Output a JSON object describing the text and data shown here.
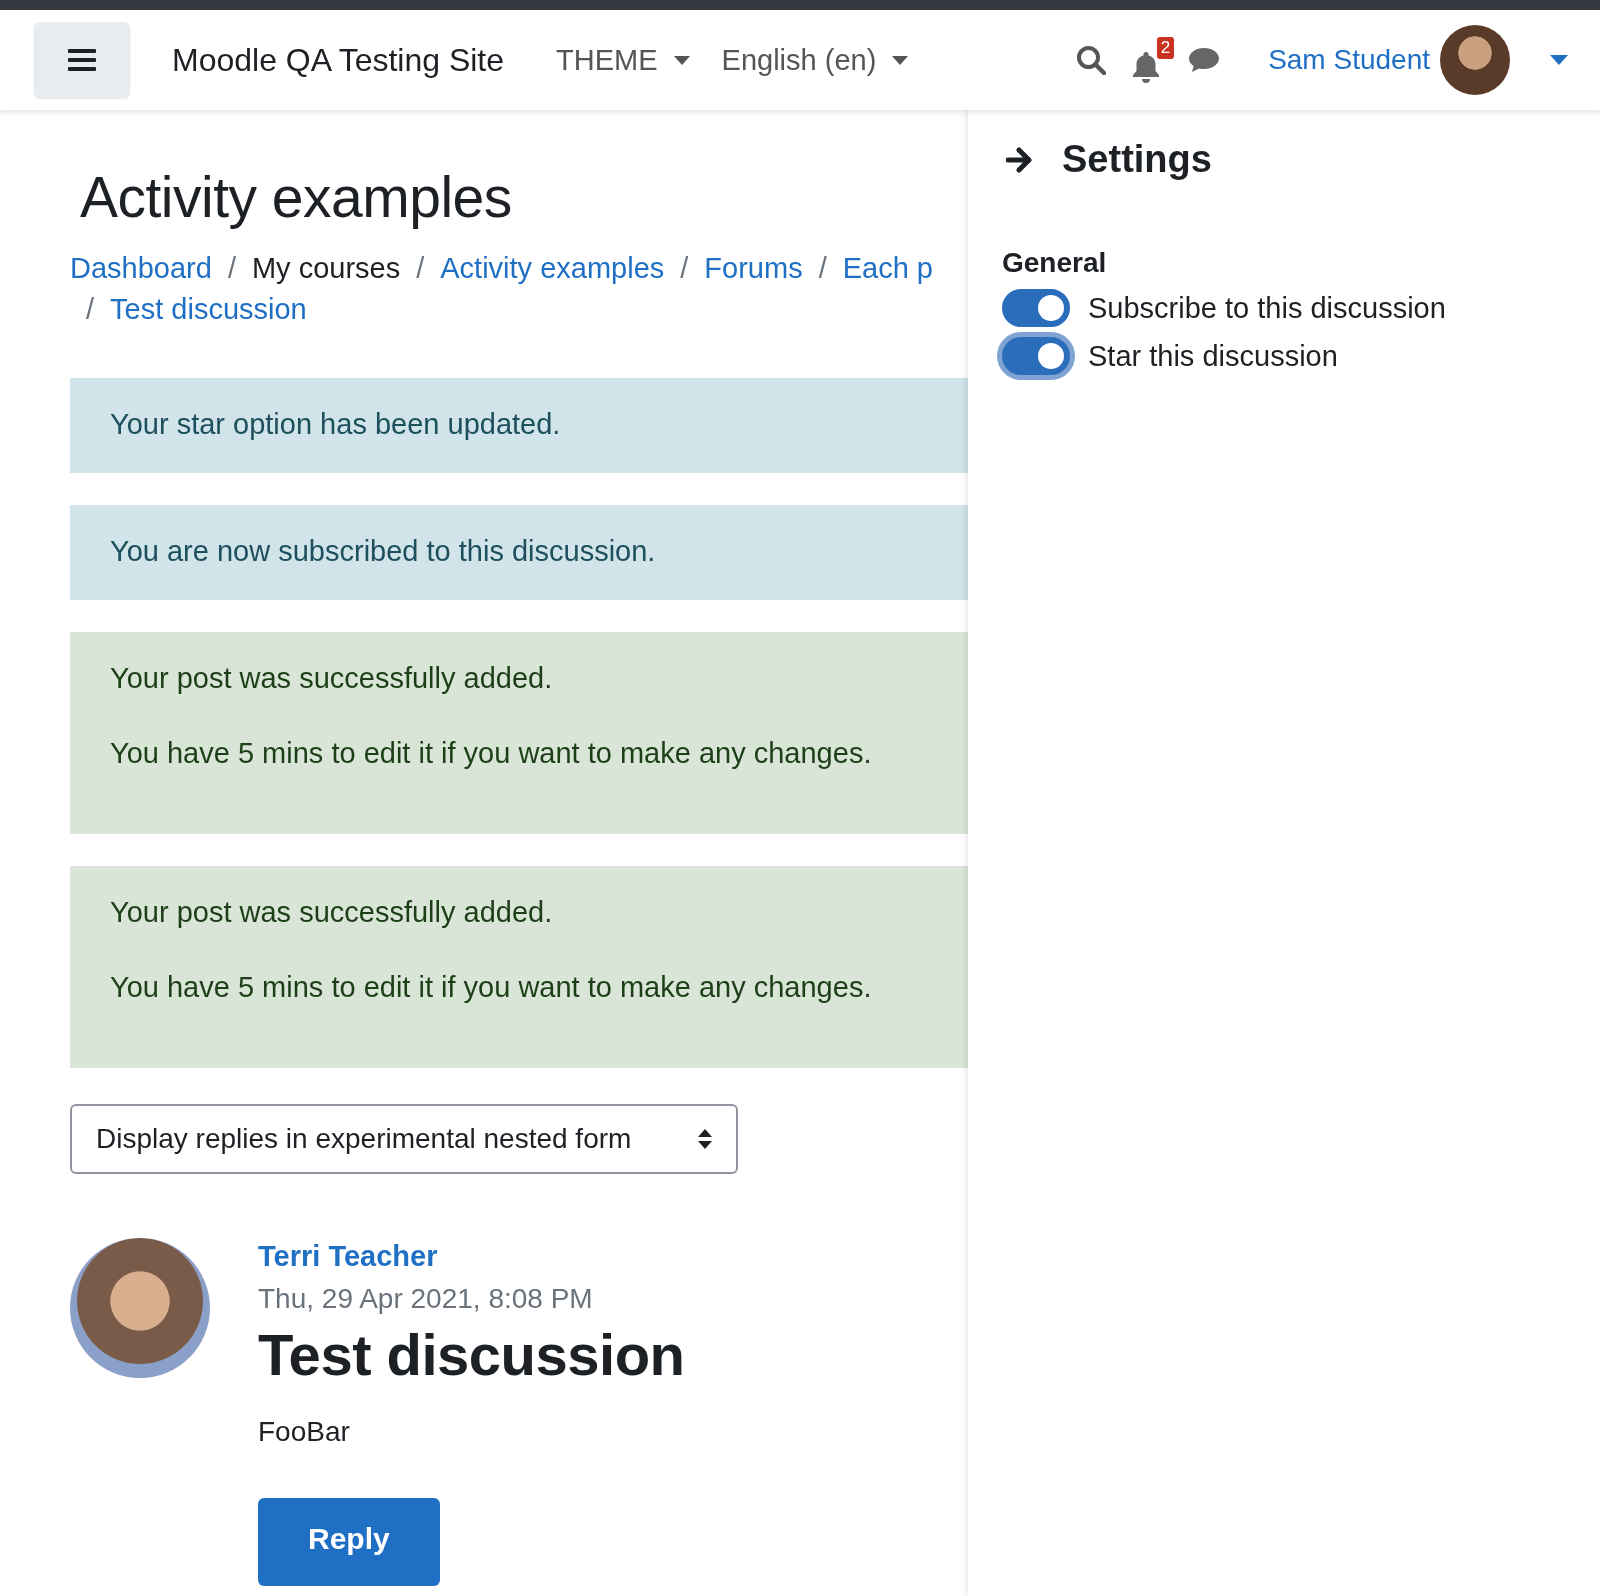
{
  "navbar": {
    "site_name": "Moodle QA Testing Site",
    "menus": [
      "THEME",
      "English (en)"
    ],
    "notification_count": "2",
    "user_name": "Sam Student"
  },
  "page": {
    "title": "Activity examples",
    "breadcrumb": [
      {
        "label": "Dashboard",
        "link": true
      },
      {
        "separator": "/",
        "label": "My courses",
        "link": false
      },
      {
        "separator": "/",
        "label": "Activity examples",
        "link": true
      },
      {
        "separator": "/",
        "label": "Forums",
        "link": true
      },
      {
        "separator": "/",
        "label": "Each p",
        "link": true
      },
      {
        "separator": "/",
        "label": "Test discussion",
        "link": true
      }
    ],
    "alerts": [
      {
        "kind": "info",
        "lines": [
          "Your star option has been updated."
        ]
      },
      {
        "kind": "info",
        "lines": [
          "You are now subscribed to this discussion."
        ]
      },
      {
        "kind": "success",
        "lines": [
          "Your post was successfully added.",
          "You have 5 mins to edit it if you want to make any changes."
        ]
      },
      {
        "kind": "success",
        "lines": [
          "Your post was successfully added.",
          "You have 5 mins to edit it if you want to make any changes."
        ]
      }
    ],
    "display_select": {
      "value": "Display replies in experimental nested form"
    },
    "post": {
      "author": "Terri Teacher",
      "date": "Thu, 29 Apr 2021, 8:08 PM",
      "title": "Test discussion",
      "body": "FooBar",
      "reply_button": "Reply"
    }
  },
  "drawer": {
    "title": "Settings",
    "section": "General",
    "toggles": [
      {
        "label": "Subscribe to this discussion",
        "on": true,
        "focused": false
      },
      {
        "label": "Star this discussion",
        "on": true,
        "focused": true
      }
    ]
  }
}
